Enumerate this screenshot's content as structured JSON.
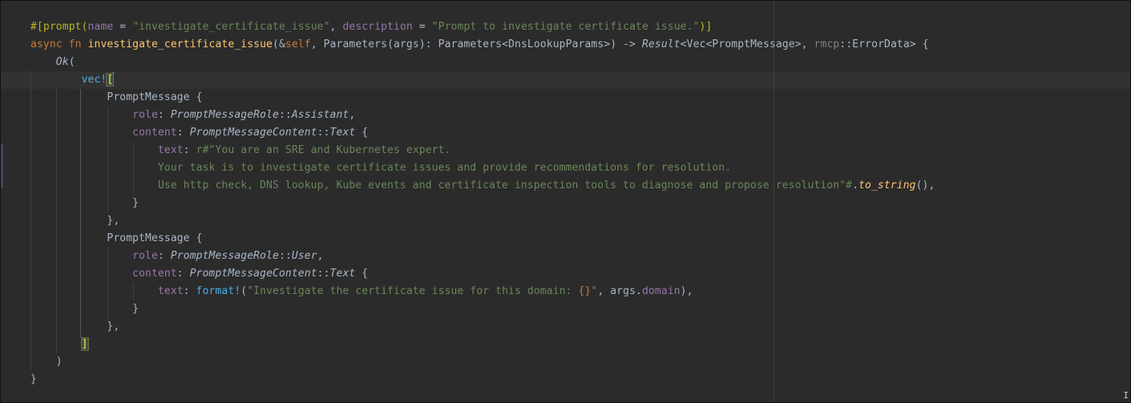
{
  "editor": {
    "lines": [
      [
        "#[",
        "prompt",
        "(",
        "name",
        " = ",
        "\"investigate_certificate_issue\"",
        ", ",
        "description",
        " = ",
        "\"Prompt to investigate certificate issue.\"",
        ")]"
      ],
      [
        "async",
        " ",
        "fn",
        " ",
        "investigate_certificate_issue",
        "(&",
        "self",
        ", ",
        "Parameters",
        "(",
        "args",
        "): ",
        "Parameters",
        "<",
        "DnsLookupParams",
        ">) -> ",
        "Result",
        "<",
        "Vec",
        "<",
        "PromptMessage",
        ">, ",
        "rmcp",
        "::",
        "ErrorData",
        "> {"
      ],
      [
        "    ",
        "Ok",
        "("
      ],
      [
        "        ",
        "vec!",
        "[",
        ""
      ],
      [
        "            ",
        "PromptMessage",
        " {"
      ],
      [
        "                ",
        "role",
        ": ",
        "PromptMessageRole",
        "::",
        "Assistant",
        ","
      ],
      [
        "                ",
        "content",
        ": ",
        "PromptMessageContent",
        "::",
        "Text",
        " {"
      ],
      [
        "                    ",
        "text",
        ": ",
        "r#\"You are an SRE and Kubernetes expert."
      ],
      [
        "                    ",
        "Your task is to investigate certificate issues and provide recommendations for resolution."
      ],
      [
        "                    ",
        "Use http check, DNS lookup, Kube events and certificate inspection tools to diagnose and propose resolution\"#",
        ".",
        "to_string",
        "(),"
      ],
      [
        "                ",
        "}"
      ],
      [
        "            ",
        "},"
      ],
      [
        "            ",
        "PromptMessage",
        " {"
      ],
      [
        "                ",
        "role",
        ": ",
        "PromptMessageRole",
        "::",
        "User",
        ","
      ],
      [
        "                ",
        "content",
        ": ",
        "PromptMessageContent",
        "::",
        "Text",
        " {"
      ],
      [
        "                    ",
        "text",
        ": ",
        "format!",
        "(",
        "\"Investigate the certificate issue for this domain: ",
        "{}",
        "\"",
        ", ",
        "args",
        ".",
        "domain",
        "),"
      ],
      [
        "                ",
        "}"
      ],
      [
        "            ",
        "},"
      ],
      [
        "        ",
        "]"
      ],
      [
        "    ",
        ")"
      ],
      [
        "",
        "}"
      ]
    ],
    "styles": [
      [
        "attr",
        "attr",
        "attr",
        "fld",
        "ty",
        "str",
        "ty",
        "fld",
        "ty",
        "str",
        "attr"
      ],
      [
        "kw",
        "ty",
        "kw",
        "ty",
        "fn",
        "ty",
        "kw",
        "ty",
        "ty",
        "ty",
        "ty",
        "ty",
        "ty",
        "ty",
        "ty",
        "ty",
        "tyit",
        "ty",
        "ty",
        "ty",
        "ty",
        "ty",
        "muted",
        "ty",
        "ty",
        "ty"
      ],
      [
        "ty",
        "tyit",
        "ty"
      ],
      [
        "ty",
        "macro",
        "bracket",
        "caret"
      ],
      [
        "ty",
        "ty",
        "ty"
      ],
      [
        "ty",
        "fld",
        "ty",
        "tyit",
        "ty",
        "tyit",
        "ty"
      ],
      [
        "ty",
        "fld",
        "ty",
        "tyit",
        "ty",
        "tyit",
        "ty"
      ],
      [
        "ty",
        "fld",
        "ty",
        "str"
      ],
      [
        "ty",
        "str"
      ],
      [
        "ty",
        "str",
        "ty",
        "fn it",
        "ty"
      ],
      [
        "ty",
        "ty"
      ],
      [
        "ty",
        "ty"
      ],
      [
        "ty",
        "ty",
        "ty"
      ],
      [
        "ty",
        "fld",
        "ty",
        "tyit",
        "ty",
        "tyit",
        "ty"
      ],
      [
        "ty",
        "fld",
        "ty",
        "tyit",
        "ty",
        "tyit",
        "ty"
      ],
      [
        "ty",
        "fld",
        "ty",
        "macro",
        "ty",
        "str",
        "kw",
        "str",
        "ty",
        "ty",
        "ty",
        "fld",
        "ty"
      ],
      [
        "ty",
        "ty"
      ],
      [
        "ty",
        "ty"
      ],
      [
        "ty",
        "bracket"
      ],
      [
        "ty",
        "ty"
      ],
      [
        "ty",
        "ty"
      ]
    ]
  }
}
